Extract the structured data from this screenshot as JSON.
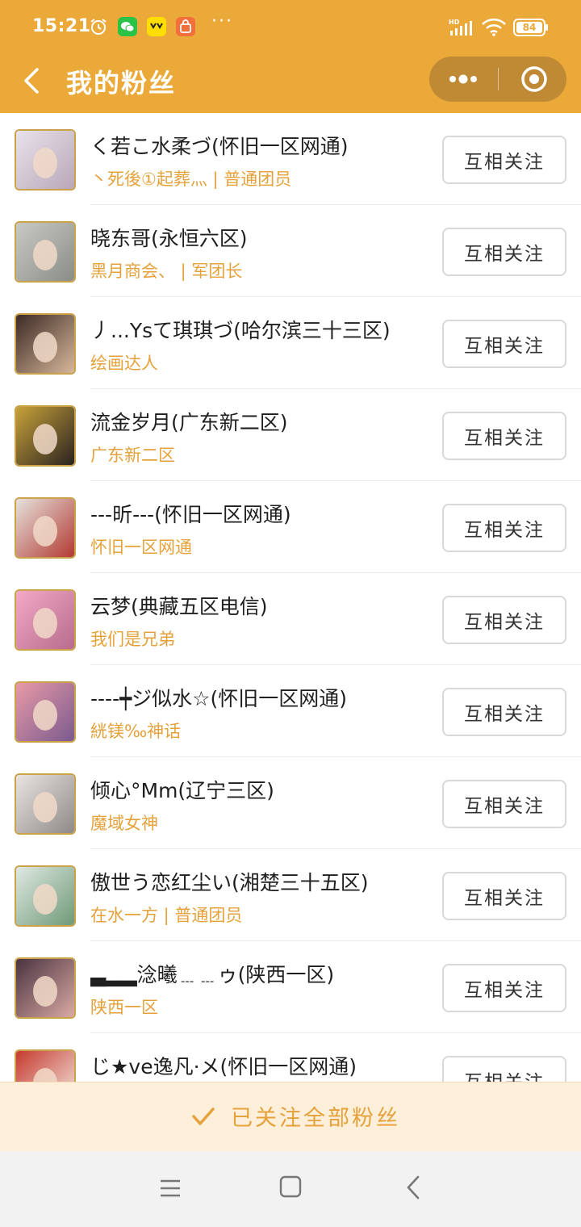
{
  "status_bar": {
    "time": "15:21",
    "battery": "84",
    "hd": "HD"
  },
  "nav": {
    "title": "我的粉丝"
  },
  "followers": [
    {
      "name": "く若こ水柔づ(怀旧一区网通)",
      "sub": "丶死後①起葬灬 | 普通团员",
      "button": "互相关注",
      "avatar_colors": [
        "#e8e2ea",
        "#b9a7b8"
      ]
    },
    {
      "name": "晓东哥(永恒六区)",
      "sub": "黑月商会、 | 军团长",
      "button": "互相关注",
      "avatar_colors": [
        "#c9c9c4",
        "#8a8e86"
      ]
    },
    {
      "name": "丿...Ysて琪琪づ(哈尔滨三十三区)",
      "sub": "绘画达人",
      "button": "互相关注",
      "avatar_colors": [
        "#3c2a25",
        "#d7b79a"
      ]
    },
    {
      "name": "流金岁月(广东新二区)",
      "sub": "广东新二区",
      "button": "互相关注",
      "avatar_colors": [
        "#c7a23a",
        "#2a2320"
      ]
    },
    {
      "name": "---昕---(怀旧一区网通)",
      "sub": "怀旧一区网通",
      "button": "互相关注",
      "avatar_colors": [
        "#e6e1dc",
        "#b23a32"
      ]
    },
    {
      "name": "云梦(典藏五区电信)",
      "sub": "我们是兄弟",
      "button": "互相关注",
      "avatar_colors": [
        "#f2a9c6",
        "#b96c8d"
      ]
    },
    {
      "name": "----┿ジ似水☆(怀旧一区网通)",
      "sub": "絖镁‰神话",
      "button": "互相关注",
      "avatar_colors": [
        "#e79aa7",
        "#7b5a8e"
      ]
    },
    {
      "name": "倾心°Mm(辽宁三区)",
      "sub": "魔域女神",
      "button": "互相关注",
      "avatar_colors": [
        "#e9e4e2",
        "#8d8a88"
      ]
    },
    {
      "name": "傲世う恋红尘い(湘楚三十五区)",
      "sub": "在水一方 | 普通团员",
      "button": "互相关注",
      "avatar_colors": [
        "#dfe8e2",
        "#6f9a77"
      ]
    },
    {
      "name": "▃▂▂淰曦﹍﹍ゥ(陕西一区)",
      "sub": "陕西一区",
      "button": "互相关注",
      "avatar_colors": [
        "#4a3340",
        "#d9a9a3"
      ]
    },
    {
      "name": "じ★ve逸凡·メ(怀旧一区网通)",
      "sub": "",
      "button": "互相关注",
      "avatar_colors": [
        "#c63a2e",
        "#f3ede6"
      ]
    }
  ],
  "footer": {
    "follow_all_label": "已关注全部粉丝"
  },
  "colors": {
    "brand": "#eba93a",
    "accent_text": "#e5a23b",
    "footer_bg": "#fdefd9"
  }
}
